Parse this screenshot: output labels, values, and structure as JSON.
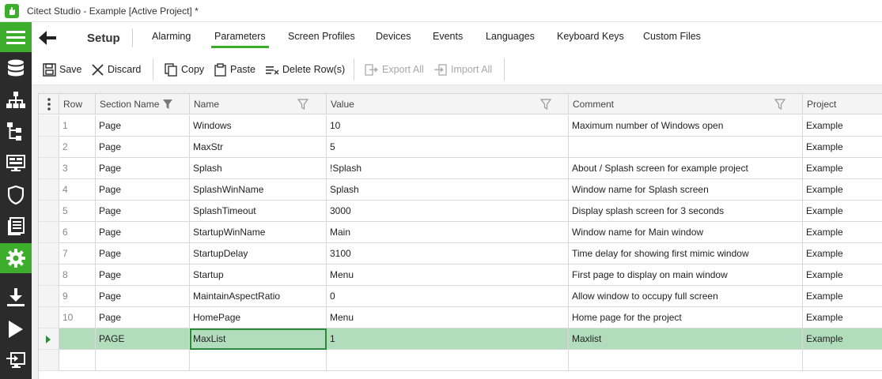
{
  "window": {
    "title": "Citect Studio - Example [Active Project] *"
  },
  "nav": {
    "section_title": "Setup",
    "tabs": [
      {
        "label": "Alarming"
      },
      {
        "label": "Parameters",
        "active": true
      },
      {
        "label": "Screen Profiles"
      },
      {
        "label": "Devices"
      },
      {
        "label": "Events"
      },
      {
        "label": "Languages"
      },
      {
        "label": "Keyboard Keys"
      },
      {
        "label": "Custom Files"
      }
    ]
  },
  "toolbar": {
    "save": "Save",
    "discard": "Discard",
    "copy": "Copy",
    "paste": "Paste",
    "delete_rows": "Delete Row(s)",
    "export_all": "Export All",
    "import_all": "Import All"
  },
  "sidebar": {
    "icons": [
      "menu-icon",
      "database-icon",
      "hierarchy-icon",
      "tree-icon",
      "screen-icon",
      "shield-icon",
      "document-icon",
      "gear-icon",
      "download-icon",
      "play-icon",
      "login-icon"
    ],
    "active": "gear-icon"
  },
  "grid": {
    "columns": [
      "Row",
      "Section Name",
      "Name",
      "Value",
      "Comment",
      "Project"
    ],
    "rows": [
      {
        "row": "1",
        "section": "Page",
        "name": "Windows",
        "value": "10",
        "comment": "Maximum number of Windows open",
        "project": "Example"
      },
      {
        "row": "2",
        "section": "Page",
        "name": "MaxStr",
        "value": "5",
        "comment": "",
        "project": "Example"
      },
      {
        "row": "3",
        "section": "Page",
        "name": "Splash",
        "value": "!Splash",
        "comment": "About / Splash screen for example project",
        "project": "Example"
      },
      {
        "row": "4",
        "section": "Page",
        "name": "SplashWinName",
        "value": "Splash",
        "comment": "Window name for Splash screen",
        "project": "Example"
      },
      {
        "row": "5",
        "section": "Page",
        "name": "SplashTimeout",
        "value": "3000",
        "comment": "Display splash screen for 3 seconds",
        "project": "Example"
      },
      {
        "row": "6",
        "section": "Page",
        "name": "StartupWinName",
        "value": "Main",
        "comment": "Window name for Main window",
        "project": "Example"
      },
      {
        "row": "7",
        "section": "Page",
        "name": "StartupDelay",
        "value": "3100",
        "comment": "Time delay for showing first mimic window",
        "project": "Example"
      },
      {
        "row": "8",
        "section": "Page",
        "name": "Startup",
        "value": "Menu",
        "comment": "First page to display on main window",
        "project": "Example"
      },
      {
        "row": "9",
        "section": "Page",
        "name": "MaintainAspectRatio",
        "value": "0",
        "comment": "Allow window to occupy full screen",
        "project": "Example"
      },
      {
        "row": "10",
        "section": "Page",
        "name": "HomePage",
        "value": "Menu",
        "comment": "Home page for the project",
        "project": "Example"
      },
      {
        "row": "",
        "section": "PAGE",
        "name": "MaxList",
        "value": "1",
        "comment": "Maxlist",
        "project": "Example",
        "selected": true
      }
    ]
  },
  "colors": {
    "accent": "#3dae2b",
    "sidebar": "#2b2b2b",
    "selected_row": "#b2ddbd"
  }
}
